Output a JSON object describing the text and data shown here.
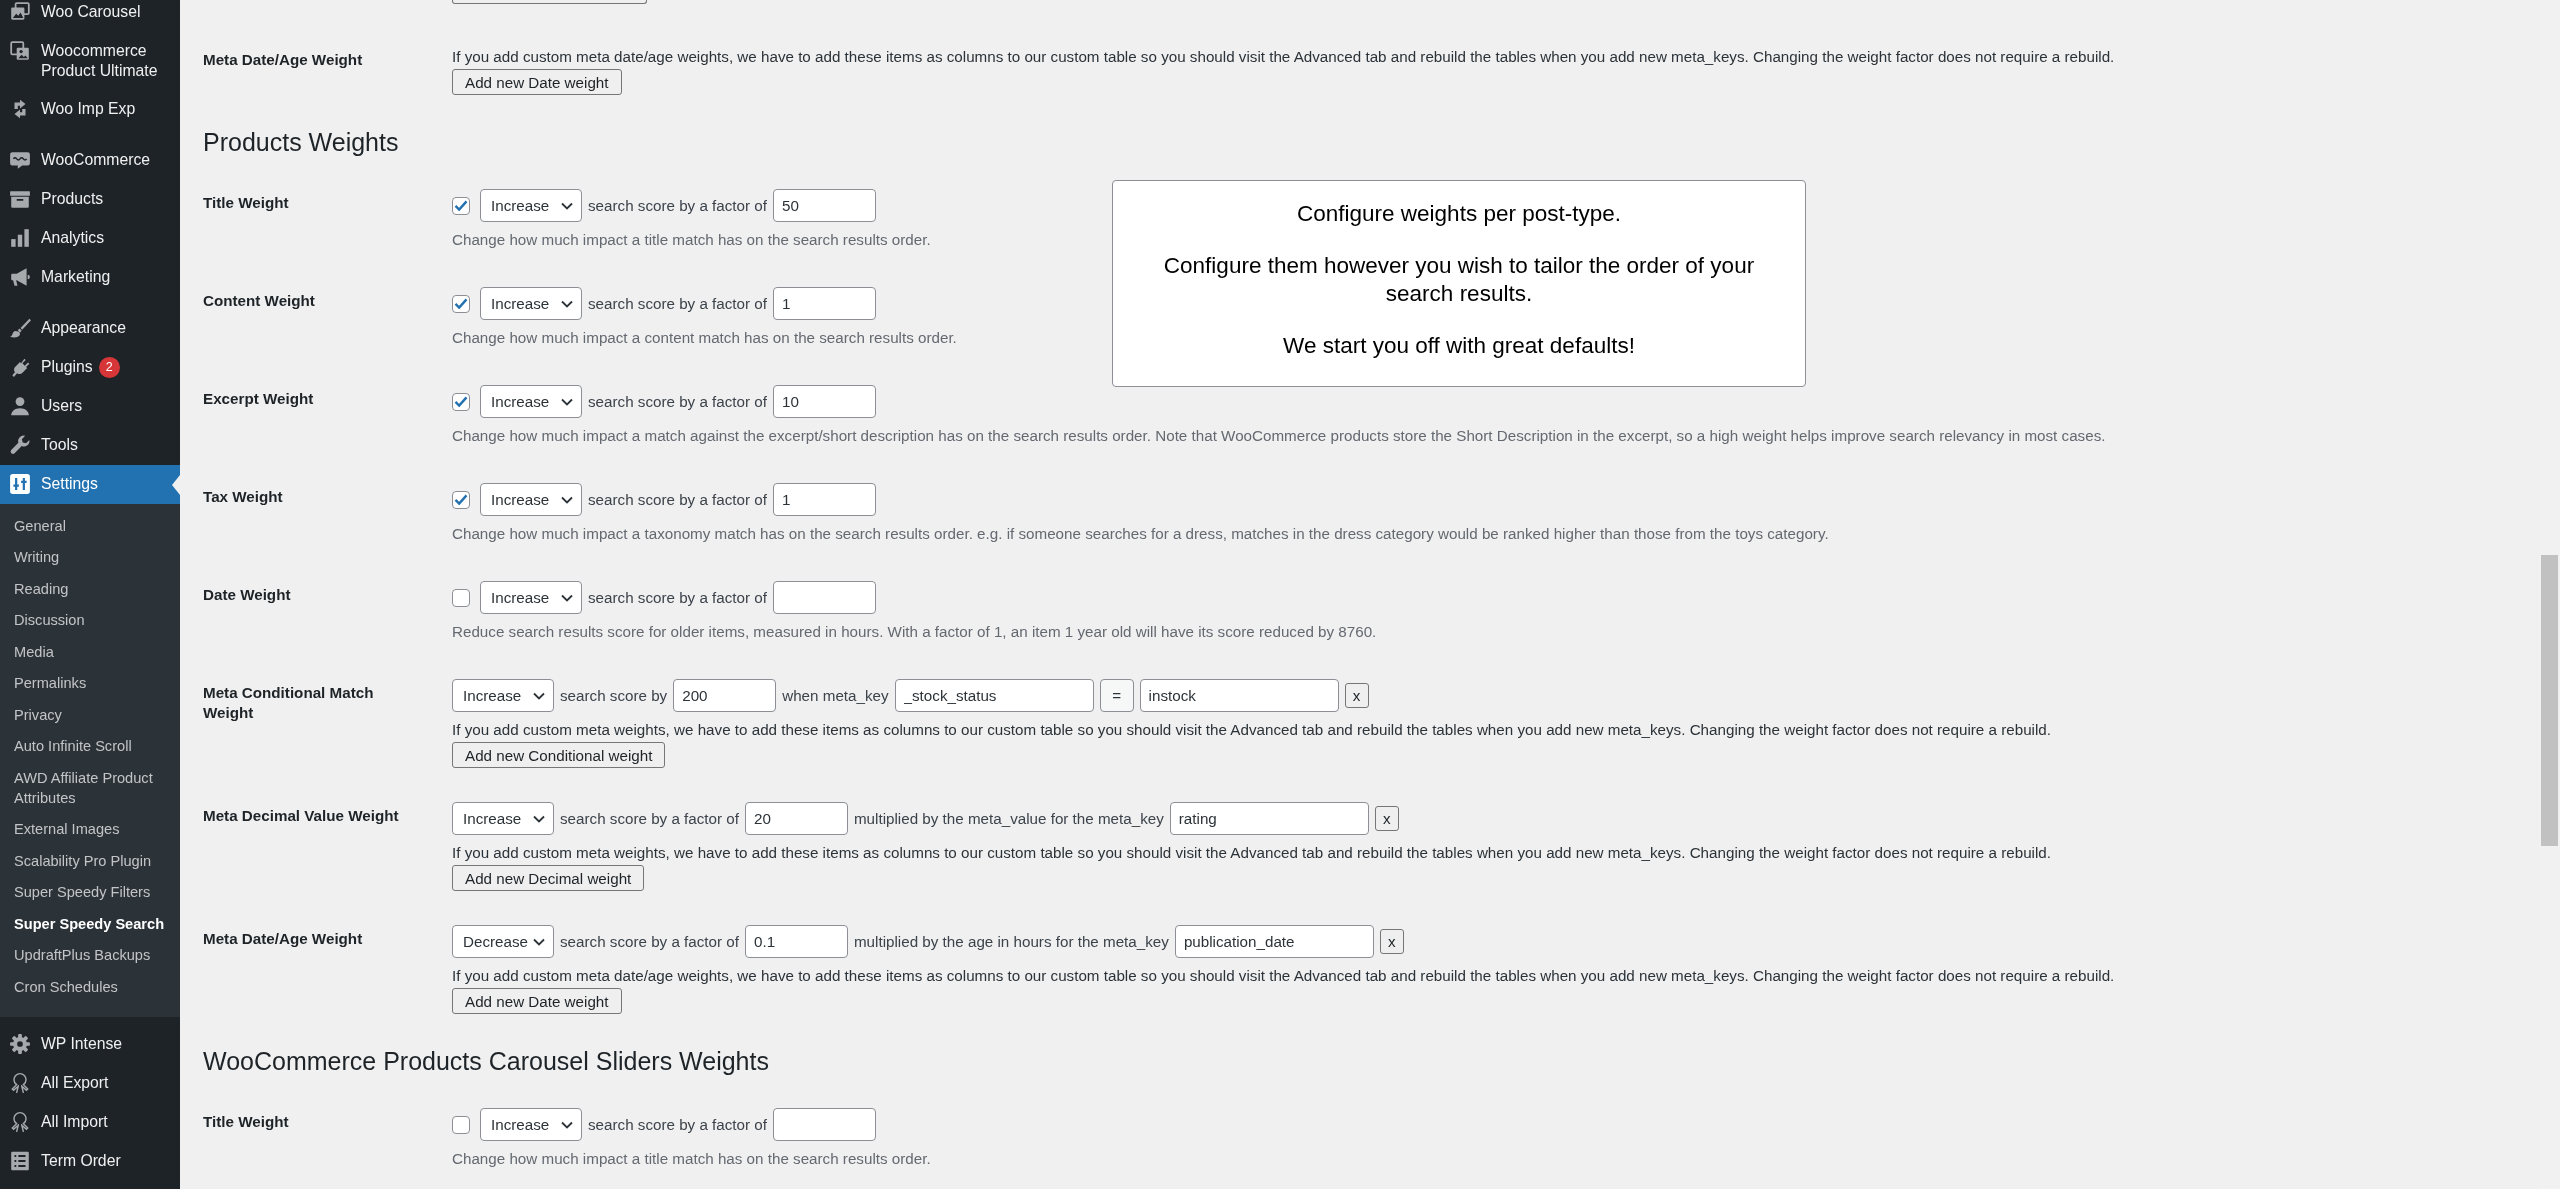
{
  "sidebar": {
    "groups": [
      [
        {
          "label": "Woo Carousel",
          "selected": false
        },
        {
          "label": "Woocommerce Product Ultimate",
          "selected": false
        },
        {
          "label": "Woo Imp Exp",
          "selected": false
        }
      ],
      [
        {
          "label": "WooCommerce",
          "selected": false
        },
        {
          "label": "Products",
          "selected": false
        },
        {
          "label": "Analytics",
          "selected": false
        },
        {
          "label": "Marketing",
          "selected": false
        }
      ],
      [
        {
          "label": "Appearance",
          "selected": false
        },
        {
          "label": "Plugins",
          "selected": false,
          "badge": "2"
        },
        {
          "label": "Users",
          "selected": false
        },
        {
          "label": "Tools",
          "selected": false
        },
        {
          "label": "Settings",
          "selected": true,
          "children": [
            {
              "label": "General",
              "selected": false
            },
            {
              "label": "Writing",
              "selected": false
            },
            {
              "label": "Reading",
              "selected": false
            },
            {
              "label": "Discussion",
              "selected": false
            },
            {
              "label": "Media",
              "selected": false
            },
            {
              "label": "Permalinks",
              "selected": false
            },
            {
              "label": "Privacy",
              "selected": false
            },
            {
              "label": "Auto Infinite Scroll",
              "selected": false
            },
            {
              "label": "AWD Affiliate Product Attributes",
              "selected": false
            },
            {
              "label": "External Images",
              "selected": false
            },
            {
              "label": "Scalability Pro Plugin",
              "selected": false
            },
            {
              "label": "Super Speedy Filters",
              "selected": false
            },
            {
              "label": "Super Speedy Search",
              "selected": true
            },
            {
              "label": "UpdraftPlus Backups",
              "selected": false
            },
            {
              "label": "Cron Schedules",
              "selected": false
            }
          ]
        },
        {
          "label": "WP Intense",
          "selected": false
        },
        {
          "label": "All Export",
          "selected": false
        },
        {
          "label": "All Import",
          "selected": false
        },
        {
          "label": "Term Order",
          "selected": false
        }
      ]
    ]
  },
  "content": {
    "sections": [
      {
        "rows": [
          {
            "label": "Meta Date/Age Weight",
            "note": "If you add custom meta date/age weights, we have to add these items as columns to our custom table so you should visit the Advanced tab and rebuild the tables when you add new meta_keys. Changing the weight factor does not require a rebuild.",
            "add_button": "Add new Date weight"
          }
        ]
      },
      {
        "heading": "Products Weights",
        "rows": [
          {
            "label": "Title Weight",
            "checked": true,
            "controls": [
              {
                "kind": "select",
                "value": "Increase"
              },
              {
                "kind": "text",
                "text": "search score by a factor of"
              },
              {
                "kind": "number",
                "value": "50"
              }
            ],
            "description": "Change how much impact a title match has on the search results order."
          },
          {
            "label": "Content Weight",
            "checked": true,
            "controls": [
              {
                "kind": "select",
                "value": "Increase"
              },
              {
                "kind": "text",
                "text": "search score by a factor of"
              },
              {
                "kind": "number",
                "value": "1"
              }
            ],
            "description": "Change how much impact a content match has on the search results order."
          },
          {
            "label": "Excerpt Weight",
            "checked": true,
            "controls": [
              {
                "kind": "select",
                "value": "Increase"
              },
              {
                "kind": "text",
                "text": "search score by a factor of"
              },
              {
                "kind": "number",
                "value": "10"
              }
            ],
            "description": "Change how much impact a match against the excerpt/short description has on the search results order. Note that WooCommerce products store the Short Description in the excerpt, so a high weight helps improve search relevancy in most cases."
          },
          {
            "label": "Tax Weight",
            "checked": true,
            "controls": [
              {
                "kind": "select",
                "value": "Increase"
              },
              {
                "kind": "text",
                "text": "search score by a factor of"
              },
              {
                "kind": "number",
                "value": "1"
              }
            ],
            "description": "Change how much impact a taxonomy match has on the search results order. e.g. if someone searches for a dress, matches in the dress category would be ranked higher than those from the toys category."
          },
          {
            "label": "Date Weight",
            "checked": false,
            "controls": [
              {
                "kind": "select",
                "value": "Increase"
              },
              {
                "kind": "text",
                "text": "search score by a factor of"
              },
              {
                "kind": "number"
              }
            ],
            "description": "Reduce search results score for older items, measured in hours. With a factor of 1, an item 1 year old will have its score reduced by 8760."
          },
          {
            "label": "Meta Conditional Match Weight",
            "controls": [
              {
                "kind": "select",
                "value": "Increase"
              },
              {
                "kind": "text",
                "text": "search score by"
              },
              {
                "kind": "number",
                "value": "200"
              },
              {
                "kind": "text",
                "text": "when meta_key"
              },
              {
                "kind": "key",
                "value": "_stock_status"
              },
              {
                "kind": "compare",
                "value": "="
              },
              {
                "kind": "key",
                "value": "instock"
              },
              {
                "kind": "remove",
                "label": "x"
              }
            ],
            "note": "If you add custom meta weights, we have to add these items as columns to our custom table so you should visit the Advanced tab and rebuild the tables when you add new meta_keys. Changing the weight factor does not require a rebuild.",
            "add_button": "Add new Conditional weight"
          },
          {
            "label": "Meta Decimal Value Weight",
            "controls": [
              {
                "kind": "select",
                "value": "Increase"
              },
              {
                "kind": "text",
                "text": "search score by a factor of"
              },
              {
                "kind": "number",
                "value": "20"
              },
              {
                "kind": "text",
                "text": "multiplied by the meta_value for the meta_key"
              },
              {
                "kind": "key",
                "value": "rating"
              },
              {
                "kind": "remove",
                "label": "x"
              }
            ],
            "note": "If you add custom meta weights, we have to add these items as columns to our custom table so you should visit the Advanced tab and rebuild the tables when you add new meta_keys. Changing the weight factor does not require a rebuild.",
            "add_button": "Add new Decimal weight"
          },
          {
            "label": "Meta Date/Age Weight",
            "controls": [
              {
                "kind": "select",
                "value": "Decrease"
              },
              {
                "kind": "text",
                "text": "search score by a factor of"
              },
              {
                "kind": "number",
                "value": "0.1"
              },
              {
                "kind": "text",
                "text": "multiplied by the age in hours for the meta_key"
              },
              {
                "kind": "key",
                "value": "publication_date"
              },
              {
                "kind": "remove",
                "label": "x"
              }
            ],
            "note": "If you add custom meta date/age weights, we have to add these items as columns to our custom table so you should visit the Advanced tab and rebuild the tables when you add new meta_keys. Changing the weight factor does not require a rebuild.",
            "add_button": "Add new Date weight"
          }
        ]
      },
      {
        "heading": "WooCommerce Products Carousel Sliders Weights",
        "rows": [
          {
            "label": "Title Weight",
            "checked": false,
            "controls": [
              {
                "kind": "select",
                "value": "Increase"
              },
              {
                "kind": "text",
                "text": "search score by a factor of"
              },
              {
                "kind": "number"
              }
            ],
            "description": "Change how much impact a title match has on the search results order."
          }
        ]
      }
    ],
    "info_box": {
      "paragraphs": [
        "Configure weights per post-type.",
        "Configure them however you wish to tailor the order of your search results.",
        "We start you off with great defaults!"
      ]
    }
  }
}
